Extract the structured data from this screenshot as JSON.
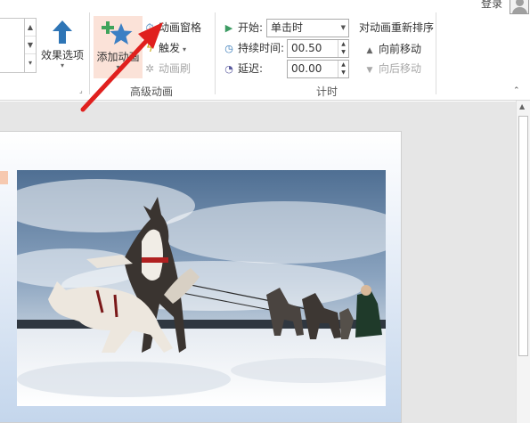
{
  "account": {
    "login_label": "登录"
  },
  "ribbon": {
    "effect_options": {
      "label": "效果选项"
    },
    "advanced_animation": {
      "add_animation_label": "添加动画",
      "animation_pane_label": "动画窗格",
      "trigger_label": "触发",
      "animation_painter_label": "动画刷",
      "group_label": "高级动画"
    },
    "timing": {
      "start_label": "开始:",
      "start_value": "单击时",
      "duration_label": "持续时间:",
      "duration_value": "00.50",
      "delay_label": "延迟:",
      "delay_value": "00.00",
      "reorder_title": "对动画重新排序",
      "move_earlier_label": "向前移动",
      "move_later_label": "向后移动",
      "group_label": "计时"
    }
  },
  "icons": {
    "effect_options": "up-arrow-icon",
    "add_animation": "star-plus-icon",
    "animation_pane": "clock-pane-icon",
    "trigger": "lightning-icon",
    "animation_painter": "painter-icon",
    "start": "play-triangle-icon",
    "duration": "clock-icon",
    "delay": "delay-icon"
  },
  "colors": {
    "accent_blue": "#2e75b6",
    "star_blue": "#3b7fc4",
    "plus_green": "#3fa45b",
    "add_animation_highlight": "#fbe2d8",
    "annotation_arrow": "#e0201e",
    "start_play_green": "#3c9b63"
  }
}
